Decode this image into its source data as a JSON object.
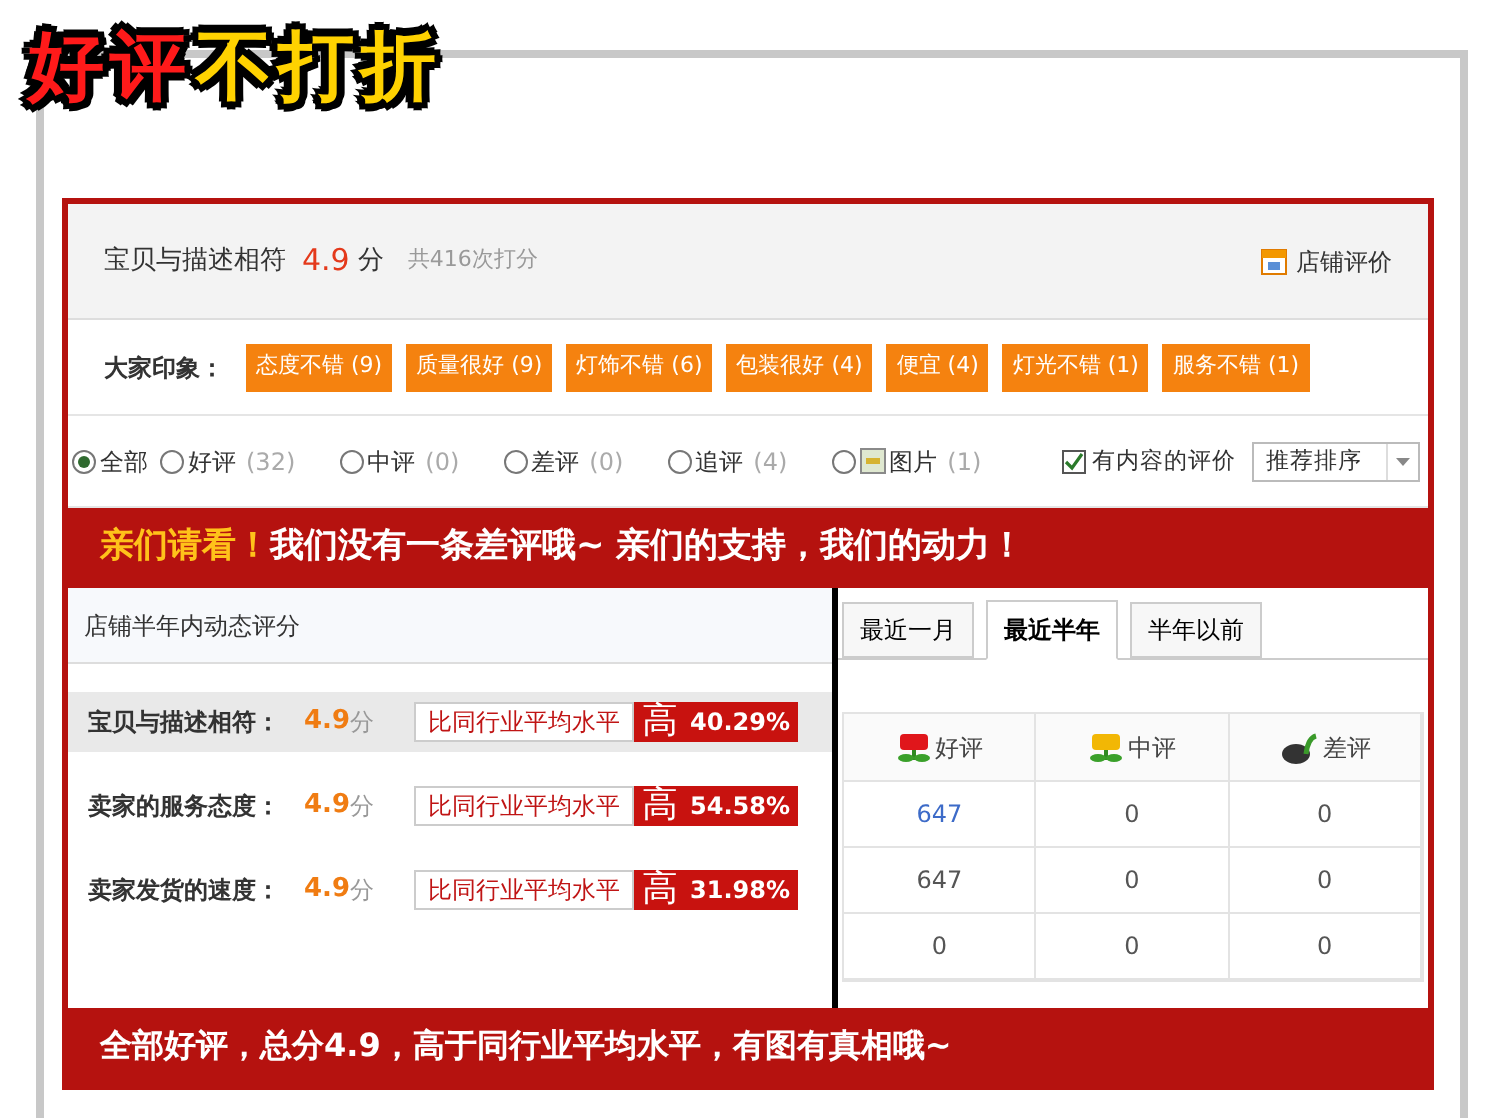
{
  "headline": [
    {
      "text": "好评",
      "color": "#ff1a1a"
    },
    {
      "text": "不打折",
      "color": "#ffd200"
    }
  ],
  "summary": {
    "label": "宝贝与描述相符",
    "score": "4.9",
    "unit": "分",
    "count": "共416次打分",
    "link": "店铺评价"
  },
  "impressions": {
    "label": "大家印象：",
    "tags": [
      "态度不错 (9)",
      "质量很好 (9)",
      "灯饰不错 (6)",
      "包装很好 (4)",
      "便宜 (4)",
      "灯光不错 (1)",
      "服务不错 (1)"
    ]
  },
  "filters": [
    {
      "kind": "plain",
      "label": "全部",
      "selected": true
    },
    {
      "kind": "plain",
      "label": "好评",
      "count": "(32)",
      "selected": false
    },
    {
      "kind": "plain",
      "label": "中评",
      "count": "(0)",
      "selected": false
    },
    {
      "kind": "plain",
      "label": "差评",
      "count": "(0)",
      "selected": false
    },
    {
      "kind": "plain",
      "label": "追评",
      "count": "(4)",
      "selected": false
    },
    {
      "kind": "image",
      "label": "图片",
      "count": "(1)",
      "selected": false
    }
  ],
  "content_filter": {
    "label": "有内容的评价",
    "checked": true
  },
  "sort": {
    "value": "推荐排序"
  },
  "banner_top": {
    "highlight": "亲们请看！",
    "text": "我们没有一条差评哦~ 亲们的支持，我们的动力！"
  },
  "dsr": {
    "title": "店铺半年内动态评分",
    "rows": [
      {
        "label": "宝贝与描述相符：",
        "score": "4.9",
        "unit": "分",
        "compare": "比同行业平均水平",
        "word": "高",
        "percent": "40.29%",
        "selected": true
      },
      {
        "label": "卖家的服务态度：",
        "score": "4.9",
        "unit": "分",
        "compare": "比同行业平均水平",
        "word": "高",
        "percent": "54.58%",
        "selected": false
      },
      {
        "label": "卖家发货的速度：",
        "score": "4.9",
        "unit": "分",
        "compare": "比同行业平均水平",
        "word": "高",
        "percent": "31.98%",
        "selected": false
      }
    ]
  },
  "period_tabs": [
    {
      "label": "最近一月",
      "selected": false
    },
    {
      "label": "最近半年",
      "selected": true
    },
    {
      "label": "半年以前",
      "selected": false
    }
  ],
  "rating_table": {
    "columns": [
      {
        "kind": "good",
        "label": "好评"
      },
      {
        "kind": "neutral",
        "label": "中评"
      },
      {
        "kind": "bad",
        "label": "差评"
      }
    ],
    "rows": [
      [
        {
          "text": "647",
          "link": true
        },
        {
          "text": "0",
          "link": false
        },
        {
          "text": "0",
          "link": false
        }
      ],
      [
        {
          "text": "647",
          "link": false
        },
        {
          "text": "0",
          "link": false
        },
        {
          "text": "0",
          "link": false
        }
      ],
      [
        {
          "text": "0",
          "link": false
        },
        {
          "text": "0",
          "link": false
        },
        {
          "text": "0",
          "link": false
        }
      ]
    ]
  },
  "banner_bottom": {
    "text": "全部好评，总分4.9，高于同行业平均水平，有图有真相哦~"
  }
}
